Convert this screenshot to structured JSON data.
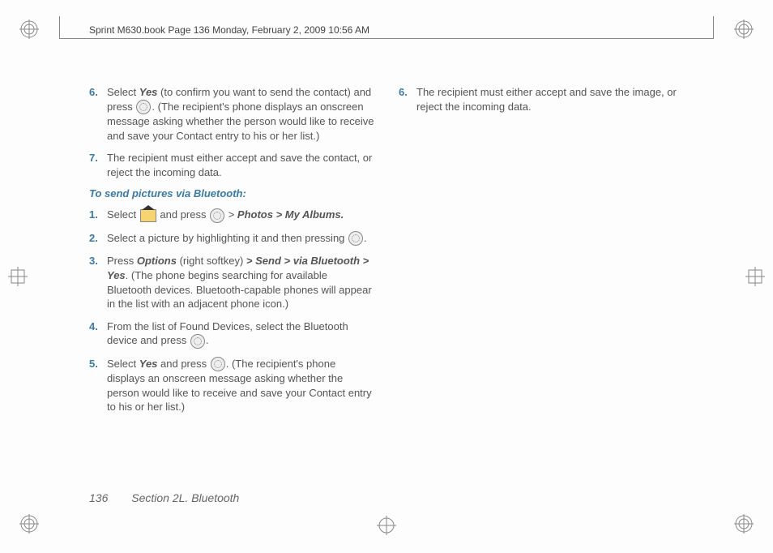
{
  "header": "Sprint M630.book  Page 136  Monday, February 2, 2009  10:56 AM",
  "left_steps_a": [
    {
      "n": "6.",
      "pre": "Select ",
      "em": "Yes",
      "post": " (to confirm you want to send the contact) and press ",
      "icon": "menu",
      "tail": ". (The recipient's phone displays an onscreen message asking whether the person would like to receive and save your Contact entry to his or her list.)"
    },
    {
      "n": "7.",
      "pre": "",
      "em": "",
      "post": "The recipient must either accept and save the contact, or reject the incoming data.",
      "icon": "",
      "tail": ""
    }
  ],
  "subhead": "To send pictures via Bluetooth:",
  "left_steps_b": [
    {
      "n": "1.",
      "pre": "Select ",
      "homeicon": true,
      "mid": " and press ",
      "menuicon": true,
      "post2": " > ",
      "em": "Photos > My Albums.",
      "tail": ""
    },
    {
      "n": "2.",
      "pre": "Select a picture by highlighting it and then pressing ",
      "menuicon": true,
      "tail": "."
    },
    {
      "n": "3.",
      "pre": "Press ",
      "em": "Options",
      "mid": " (right softkey) ",
      "em2": "> Send > via Bluetooth > Yes",
      "tail": ". (The phone begins searching for available Bluetooth devices. Bluetooth-capable phones will appear in the list with an adjacent phone icon.)"
    },
    {
      "n": "4.",
      "pre": "From the list of Found Devices, select the Bluetooth device and press ",
      "menuicon": true,
      "tail": "."
    },
    {
      "n": "5.",
      "pre": "Select ",
      "em": "Yes",
      "mid": " and press ",
      "menuicon": true,
      "tail": ". (The recipient's phone displays an onscreen message asking whether the person would like to receive and save your Contact entry to his or her list.)"
    }
  ],
  "right_steps": [
    {
      "n": "6.",
      "text": "The recipient must either accept and save the image, or reject the incoming data."
    }
  ],
  "footer": {
    "page": "136",
    "section": "Section 2L. Bluetooth"
  }
}
